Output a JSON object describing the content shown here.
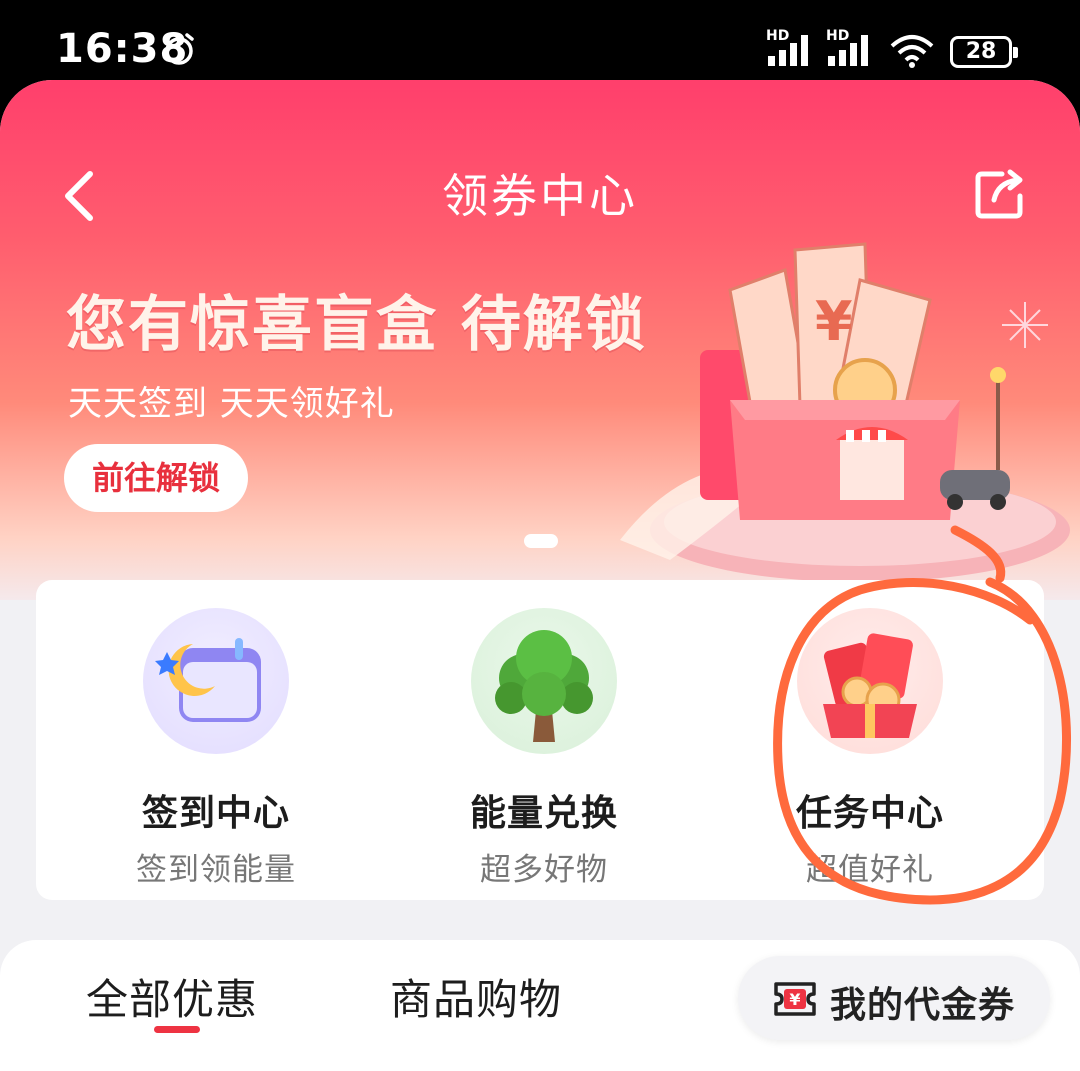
{
  "status_bar": {
    "time": "16:38",
    "signal_1_label": "HD",
    "signal_2_label": "HD",
    "battery": "28"
  },
  "nav": {
    "title": "领券中心"
  },
  "banner": {
    "headline": "您有惊喜盲盒 待解锁",
    "subline": "天天签到 天天领好礼",
    "button": "前往解锁"
  },
  "entries": [
    {
      "title": "签到中心",
      "subtitle": "签到领能量",
      "icon": "moon-calendar-icon"
    },
    {
      "title": "能量兑换",
      "subtitle": "超多好物",
      "icon": "tree-icon"
    },
    {
      "title": "任务中心",
      "subtitle": "超值好礼",
      "icon": "red-envelope-gift-icon"
    }
  ],
  "tabs": {
    "all": "全部优惠",
    "shopping": "商品购物",
    "my_vouchers": "我的代金券"
  },
  "colors": {
    "accent": "#ee3342",
    "banner_top": "#ff3f6c",
    "annotation": "#ff6a3d"
  }
}
